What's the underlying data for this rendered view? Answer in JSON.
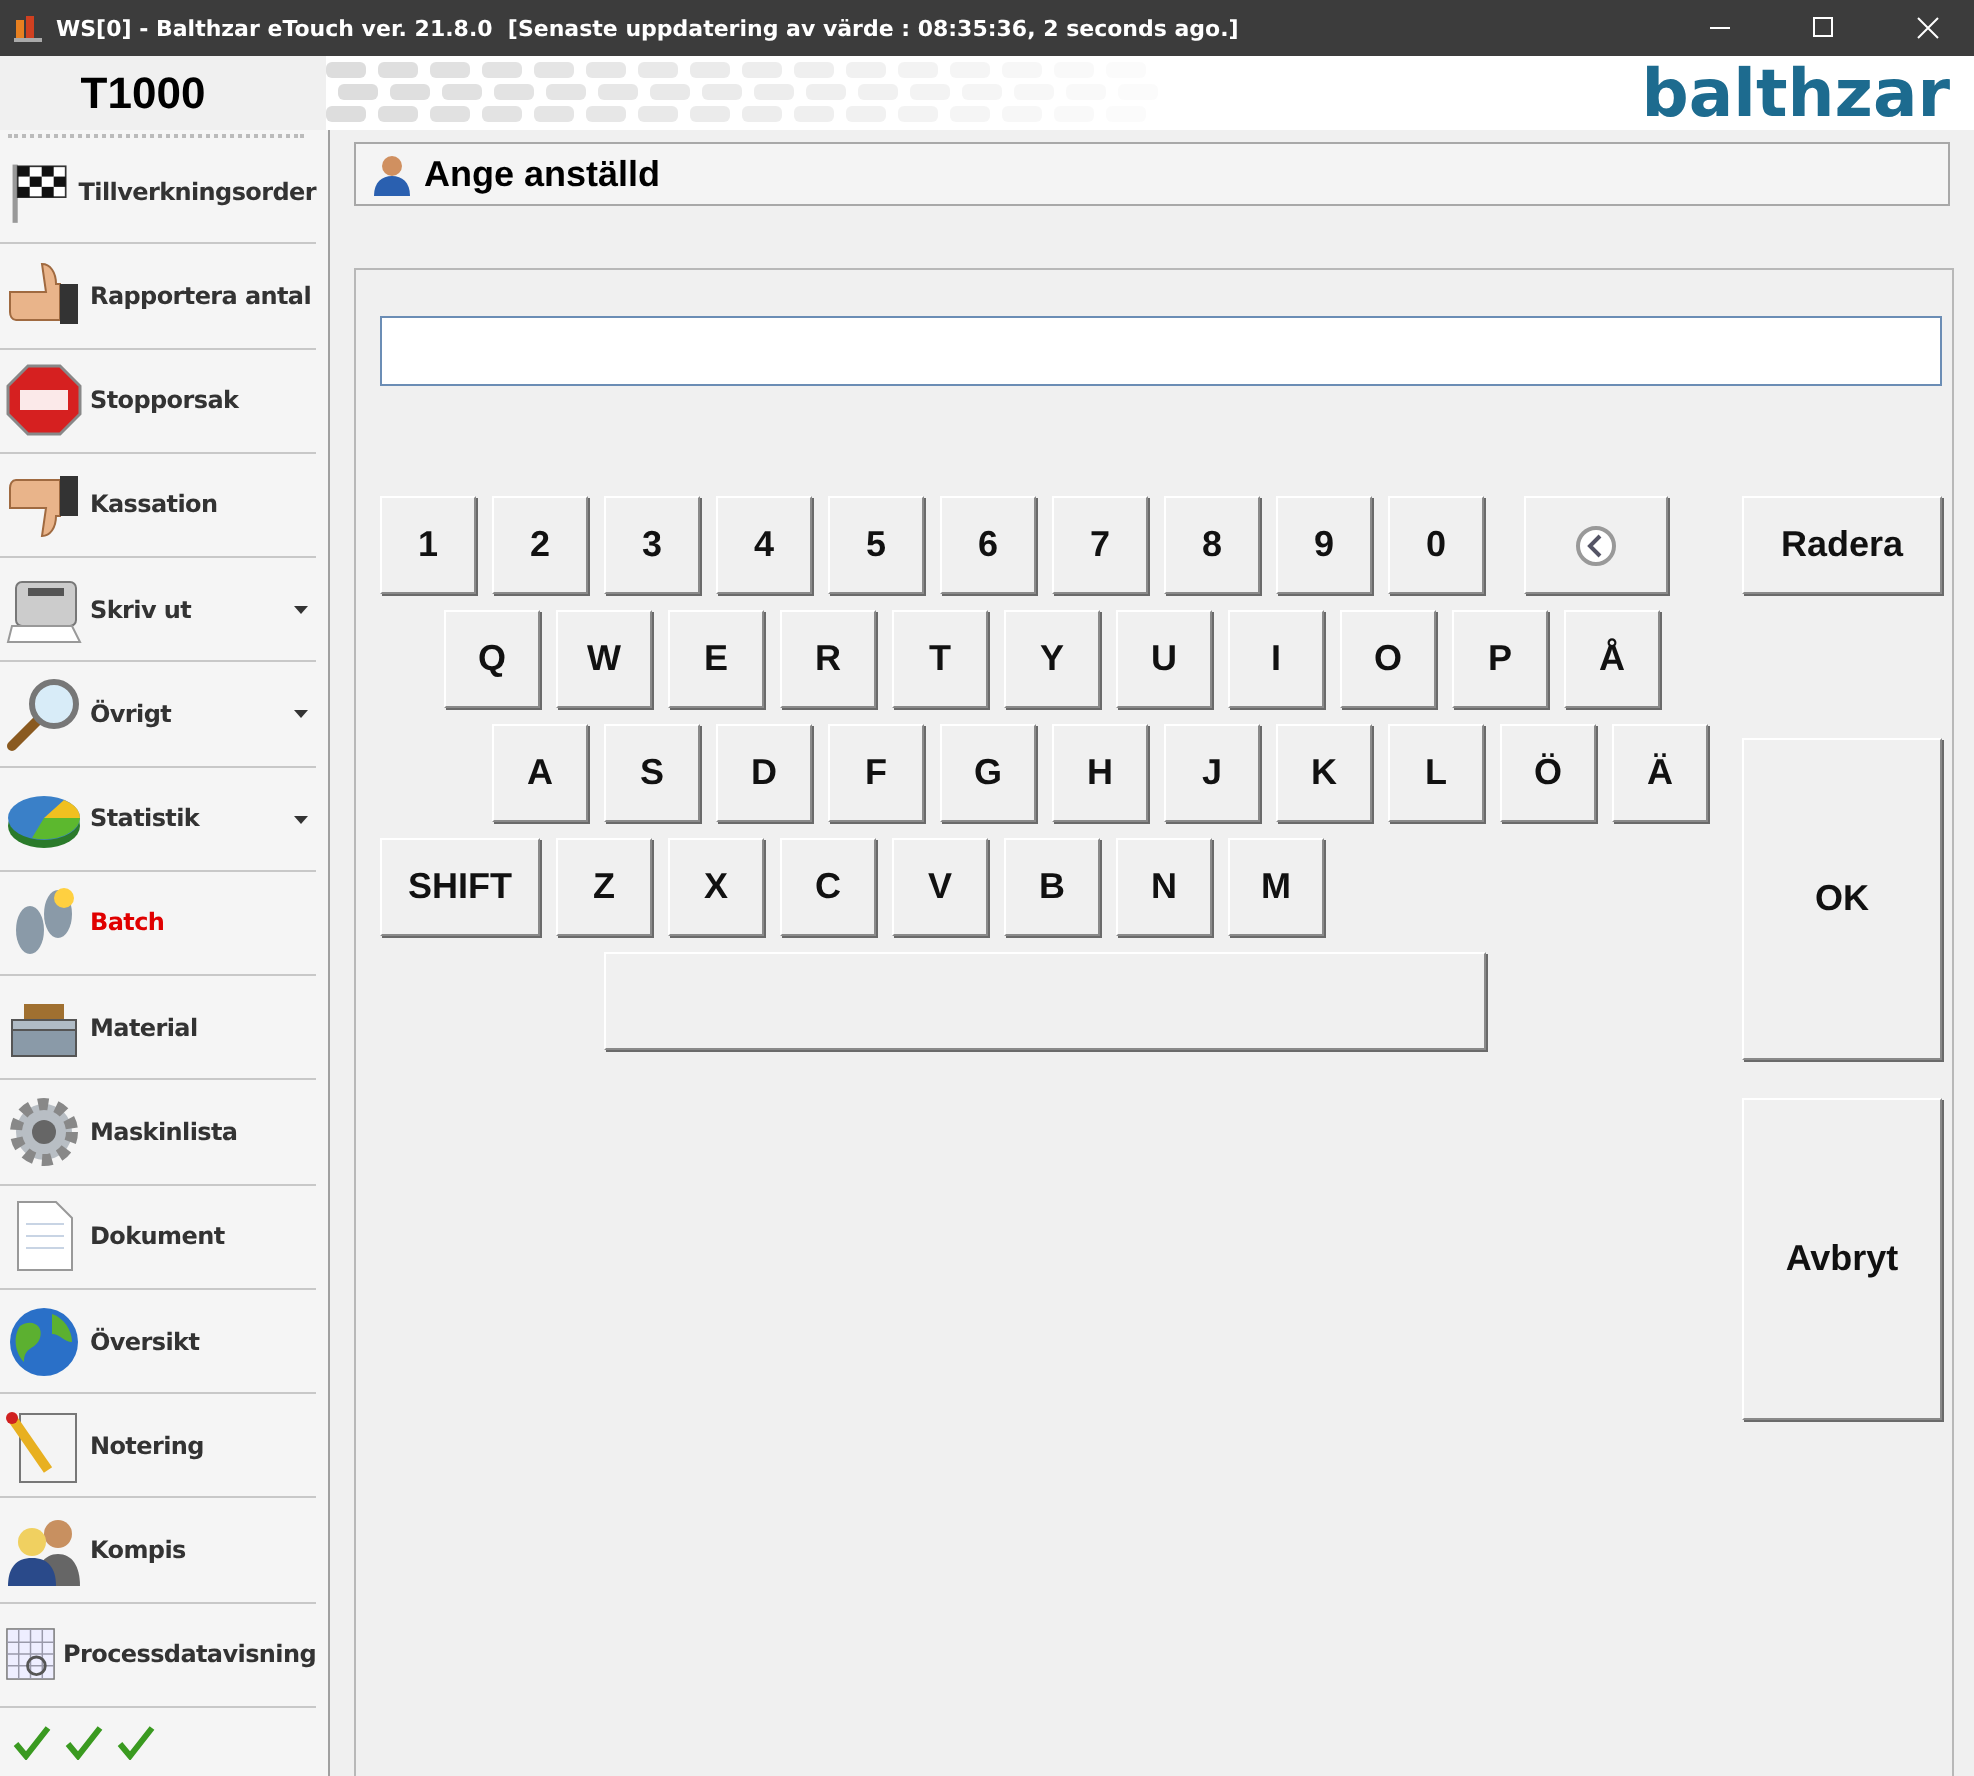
{
  "window": {
    "title": "WS[0] - Balthzar eTouch ver. 21.8.0  [Senaste uppdatering av värde : 08:35:36, 2 seconds ago.]"
  },
  "header": {
    "station": "T1000",
    "logo": "balthzar"
  },
  "sidebar": {
    "items": [
      {
        "label": "Tillverkningsorder",
        "selected": false,
        "submenu": false
      },
      {
        "label": "Rapportera antal",
        "selected": false,
        "submenu": false
      },
      {
        "label": "Stopporsak",
        "selected": false,
        "submenu": false
      },
      {
        "label": "Kassation",
        "selected": false,
        "submenu": false
      },
      {
        "label": "Skriv ut",
        "selected": false,
        "submenu": true
      },
      {
        "label": "Övrigt",
        "selected": false,
        "submenu": true
      },
      {
        "label": "Statistik",
        "selected": false,
        "submenu": true
      },
      {
        "label": "Batch",
        "selected": true,
        "submenu": false
      },
      {
        "label": "Material",
        "selected": false,
        "submenu": false
      },
      {
        "label": "Maskinlista",
        "selected": false,
        "submenu": false
      },
      {
        "label": "Dokument",
        "selected": false,
        "submenu": false
      },
      {
        "label": "Översikt",
        "selected": false,
        "submenu": false
      },
      {
        "label": "Notering",
        "selected": false,
        "submenu": false
      },
      {
        "label": "Kompis",
        "selected": false,
        "submenu": false
      },
      {
        "label": "Processdatavisning",
        "selected": false,
        "submenu": false
      }
    ]
  },
  "dialog": {
    "title": "Ange anställd",
    "keyboard": [
      [
        {
          "kind": "key",
          "label": "1"
        },
        {
          "kind": "key",
          "label": "2"
        },
        {
          "kind": "key",
          "label": "3"
        },
        {
          "kind": "key",
          "label": "4"
        },
        {
          "kind": "key",
          "label": "5"
        },
        {
          "kind": "key",
          "label": "6"
        },
        {
          "kind": "key",
          "label": "7"
        },
        {
          "kind": "key",
          "label": "8"
        },
        {
          "kind": "key",
          "label": "9"
        },
        {
          "kind": "key",
          "label": "0"
        },
        {
          "kind": "backspace"
        }
      ],
      [
        {
          "kind": "key",
          "label": "Q"
        },
        {
          "kind": "key",
          "label": "W"
        },
        {
          "kind": "key",
          "label": "E"
        },
        {
          "kind": "key",
          "label": "R"
        },
        {
          "kind": "key",
          "label": "T"
        },
        {
          "kind": "key",
          "label": "Y"
        },
        {
          "kind": "key",
          "label": "U"
        },
        {
          "kind": "key",
          "label": "I"
        },
        {
          "kind": "key",
          "label": "O"
        },
        {
          "kind": "key",
          "label": "P"
        },
        {
          "kind": "key",
          "label": "Å"
        }
      ],
      [
        {
          "kind": "key",
          "label": "A"
        },
        {
          "kind": "key",
          "label": "S"
        },
        {
          "kind": "key",
          "label": "D"
        },
        {
          "kind": "key",
          "label": "F"
        },
        {
          "kind": "key",
          "label": "G"
        },
        {
          "kind": "key",
          "label": "H"
        },
        {
          "kind": "key",
          "label": "J"
        },
        {
          "kind": "key",
          "label": "K"
        },
        {
          "kind": "key",
          "label": "L"
        },
        {
          "kind": "key",
          "label": "Ö"
        },
        {
          "kind": "key",
          "label": "Ä"
        }
      ],
      [
        {
          "kind": "wide",
          "label": "SHIFT"
        },
        {
          "kind": "key",
          "label": "Z"
        },
        {
          "kind": "key",
          "label": "X"
        },
        {
          "kind": "key",
          "label": "C"
        },
        {
          "kind": "key",
          "label": "V"
        },
        {
          "kind": "key",
          "label": "B"
        },
        {
          "kind": "key",
          "label": "N"
        },
        {
          "kind": "key",
          "label": "M"
        }
      ],
      [
        {
          "kind": "space"
        }
      ]
    ],
    "actions": [
      {
        "label": "Radera"
      },
      {
        "label": "OK"
      },
      {
        "label": "Avbryt"
      }
    ]
  }
}
